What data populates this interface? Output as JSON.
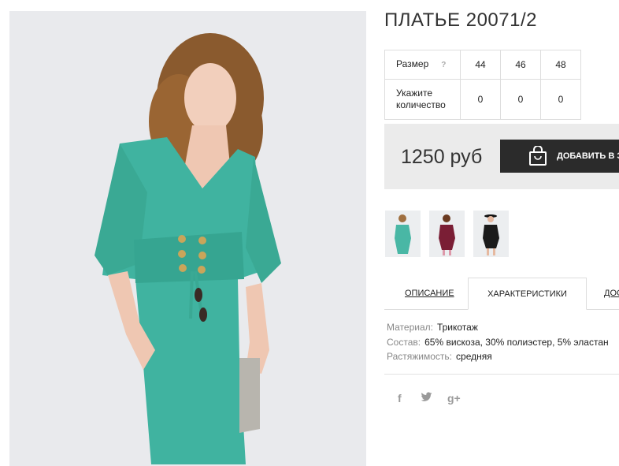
{
  "product": {
    "title": "ПЛАТЬЕ 20071/2",
    "photo_alt": "Платье",
    "colors": {
      "dress": "#3fb39f",
      "accent": "#2b2b2b"
    }
  },
  "sizes": {
    "size_label": "Размер",
    "help_icon": "?",
    "quantity_label_line1": "Укажите",
    "quantity_label_line2": "количество",
    "options": [
      {
        "size": "44",
        "qty": "0"
      },
      {
        "size": "46",
        "qty": "0"
      },
      {
        "size": "48",
        "qty": "0"
      }
    ]
  },
  "purchase": {
    "price": "1250 руб",
    "add_button_label": "ДОБАВИТЬ В З",
    "icon": "shopping-bag-icon"
  },
  "thumbnails": [
    {
      "name": "thumb-mint"
    },
    {
      "name": "thumb-burgundy"
    },
    {
      "name": "thumb-black"
    }
  ],
  "tabs": [
    {
      "label": "ОПИСАНИЕ",
      "active": false
    },
    {
      "label": "ХАРАКТЕРИСТИКИ",
      "active": true
    },
    {
      "label": "ДОС",
      "active": false
    }
  ],
  "specs": [
    {
      "key": "Материал:",
      "value": "Трикотаж"
    },
    {
      "key": "Состав:",
      "value": "65% вискоза, 30% полиэстер, 5% эластан"
    },
    {
      "key": "Растяжимость:",
      "value": "средняя"
    }
  ],
  "social": [
    {
      "icon": "facebook-icon",
      "glyph": "f"
    },
    {
      "icon": "twitter-icon",
      "glyph": "🐦"
    },
    {
      "icon": "google-plus-icon",
      "glyph": "g+"
    }
  ]
}
